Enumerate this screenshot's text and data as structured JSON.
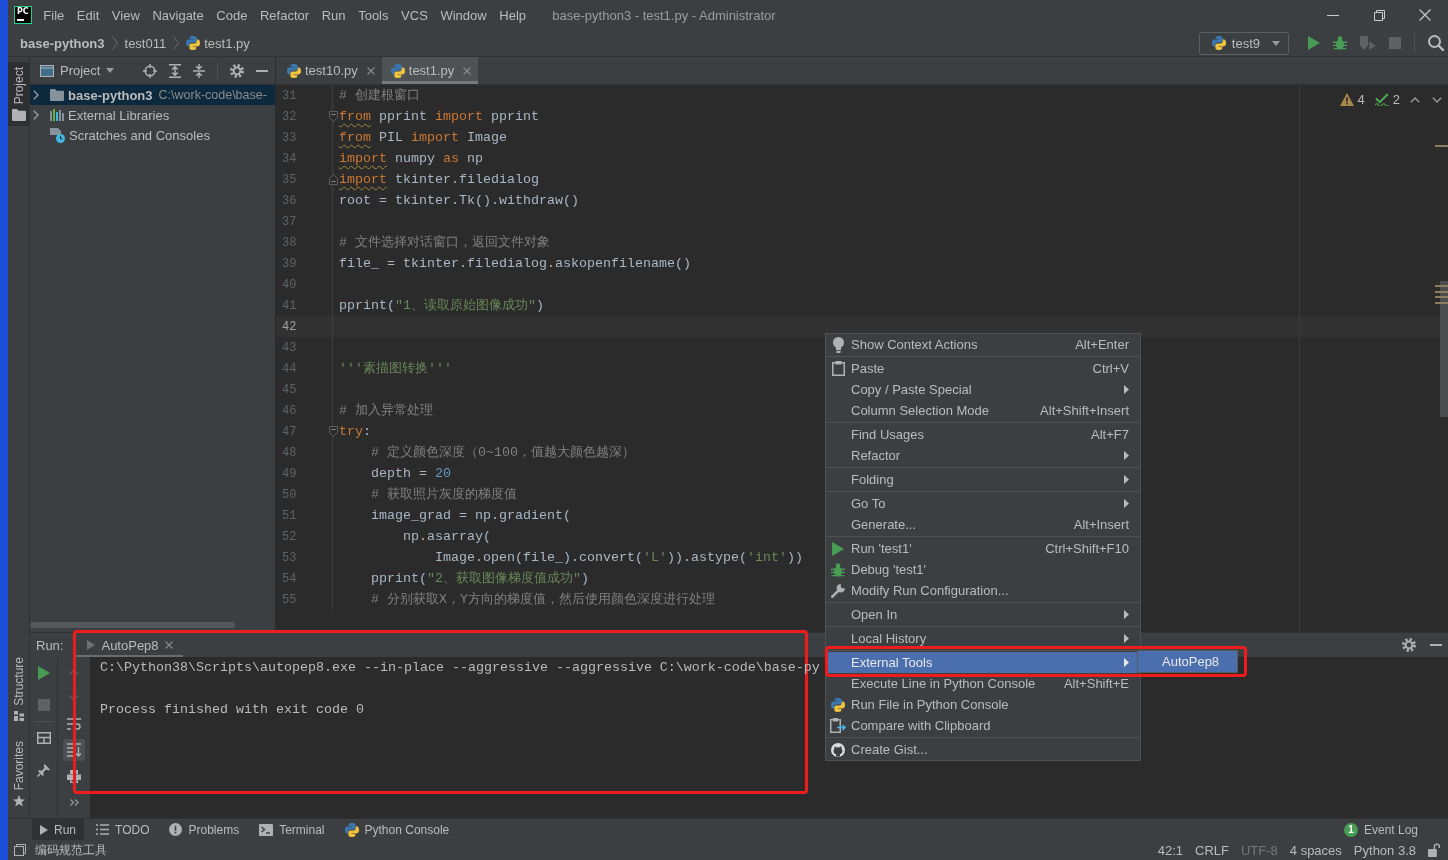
{
  "title_bar": {
    "logo": "PC",
    "menus": [
      "File",
      "Edit",
      "View",
      "Navigate",
      "Code",
      "Refactor",
      "Run",
      "Tools",
      "VCS",
      "Window",
      "Help"
    ],
    "title": "base-python3 - test1.py - Administrator"
  },
  "nav_bar": {
    "breadcrumbs": [
      {
        "kind": "project",
        "label": "base-python3"
      },
      {
        "kind": "folder",
        "label": "test011"
      },
      {
        "kind": "file",
        "label": "test1.py"
      }
    ],
    "run_config": "test9",
    "actions": [
      {
        "disabled": false
      },
      {
        "disabled": false
      },
      {
        "disabled": true
      },
      {
        "disabled": true
      }
    ]
  },
  "tool_strip": {
    "top": [
      {
        "label": "Project",
        "selected": true
      }
    ],
    "bottom": [
      {
        "label": "Structure",
        "selected": false
      },
      {
        "label": "Favorites",
        "selected": false
      }
    ]
  },
  "project_panel": {
    "title": "Project",
    "tree": [
      {
        "kind": "project",
        "label": "base-python3",
        "path": "C:\\work-code\\base-",
        "selected": true,
        "expanded": false
      },
      {
        "kind": "library",
        "label": "External Libraries",
        "selected": false,
        "expanded": false
      },
      {
        "kind": "scratches",
        "label": "Scratches and Consoles",
        "selected": false
      }
    ]
  },
  "editor": {
    "tabs": [
      {
        "label": "test10.py",
        "selected": false
      },
      {
        "label": "test1.py",
        "selected": true
      }
    ],
    "inspections": [
      {
        "kind": "warning",
        "count": "4"
      },
      {
        "kind": "weak_warning",
        "count": "2"
      }
    ],
    "lines": [
      {
        "number": "31",
        "current": false,
        "warning": false,
        "tokens": [
          {
            "kind": "comment",
            "text": "# 创建根窗口"
          }
        ]
      },
      {
        "number": "32",
        "current": false,
        "warning": true,
        "fold": {
          "kind": "start"
        },
        "tokens": [
          {
            "kind": "keyword",
            "text": "from"
          },
          {
            "kind": "plain",
            "text": " pprint "
          },
          {
            "kind": "keyword",
            "text": "import"
          },
          {
            "kind": "plain",
            "text": " pprint"
          }
        ]
      },
      {
        "number": "33",
        "current": false,
        "warning": true,
        "tokens": [
          {
            "kind": "keyword",
            "text": "from"
          },
          {
            "kind": "plain",
            "text": " PIL "
          },
          {
            "kind": "keyword",
            "text": "import"
          },
          {
            "kind": "plain",
            "text": " Image"
          }
        ]
      },
      {
        "number": "34",
        "current": false,
        "warning": true,
        "tokens": [
          {
            "kind": "keyword",
            "text": "import"
          },
          {
            "kind": "plain",
            "text": " numpy "
          },
          {
            "kind": "keyword",
            "text": "as"
          },
          {
            "kind": "plain",
            "text": " np"
          }
        ]
      },
      {
        "number": "35",
        "current": false,
        "warning": true,
        "fold": {
          "kind": "end"
        },
        "tokens": [
          {
            "kind": "keyword",
            "text": "import"
          },
          {
            "kind": "plain",
            "text": " tkinter.filedialog"
          }
        ]
      },
      {
        "number": "36",
        "current": false,
        "warning": false,
        "tokens": [
          {
            "kind": "plain",
            "text": "root = tkinter.Tk().withdraw()"
          }
        ]
      },
      {
        "number": "37",
        "current": false
      },
      {
        "number": "38",
        "current": false,
        "warning": false,
        "tokens": [
          {
            "kind": "comment",
            "text": "# 文件选择对话窗口，返回文件对象"
          }
        ]
      },
      {
        "number": "39",
        "current": false,
        "warning": false,
        "tokens": [
          {
            "kind": "plain",
            "text": "file_ = tkinter.filedialog.askopenfilename()"
          }
        ]
      },
      {
        "number": "40",
        "current": false
      },
      {
        "number": "41",
        "current": false,
        "warning": false,
        "tokens": [
          {
            "kind": "plain",
            "text": "pprint("
          },
          {
            "kind": "string",
            "text": "\"1、读取原始图像成功\""
          },
          {
            "kind": "plain",
            "text": ")"
          }
        ]
      },
      {
        "number": "42",
        "current": true
      },
      {
        "number": "43",
        "current": false
      },
      {
        "number": "44",
        "current": false,
        "warning": false,
        "tokens": [
          {
            "kind": "string",
            "text": "'''素描图转换'''"
          }
        ]
      },
      {
        "number": "45",
        "current": false
      },
      {
        "number": "46",
        "current": false,
        "warning": false,
        "tokens": [
          {
            "kind": "comment",
            "text": "# 加入异常处理"
          }
        ]
      },
      {
        "number": "47",
        "current": false,
        "warning": false,
        "fold": {
          "kind": "start"
        },
        "tokens": [
          {
            "kind": "keyword",
            "text": "try"
          },
          {
            "kind": "plain",
            "text": ":"
          }
        ]
      },
      {
        "number": "48",
        "current": false,
        "warning": false,
        "tokens": [
          {
            "kind": "comment",
            "text": "    # 定义颜色深度（0~100，值越大颜色越深）"
          }
        ]
      },
      {
        "number": "49",
        "current": false,
        "warning": false,
        "tokens": [
          {
            "kind": "plain",
            "text": "    depth = "
          },
          {
            "kind": "number",
            "text": "20"
          }
        ]
      },
      {
        "number": "50",
        "current": false,
        "warning": false,
        "tokens": [
          {
            "kind": "comment",
            "text": "    # 获取照片灰度的梯度值"
          }
        ]
      },
      {
        "number": "51",
        "current": false,
        "warning": false,
        "tokens": [
          {
            "kind": "plain",
            "text": "    image_grad = np.gradient("
          }
        ]
      },
      {
        "number": "52",
        "current": false,
        "warning": false,
        "tokens": [
          {
            "kind": "plain",
            "text": "        np.asarray("
          }
        ]
      },
      {
        "number": "53",
        "current": false,
        "warning": false,
        "tokens": [
          {
            "kind": "plain",
            "text": "            Image.open(file_).convert("
          },
          {
            "kind": "string",
            "text": "'L'"
          },
          {
            "kind": "plain",
            "text": ")).astype("
          },
          {
            "kind": "string",
            "text": "'int'"
          },
          {
            "kind": "plain",
            "text": "))"
          }
        ]
      },
      {
        "number": "54",
        "current": false,
        "warning": false,
        "tokens": [
          {
            "kind": "plain",
            "text": "    pprint("
          },
          {
            "kind": "string",
            "text": "\"2、获取图像梯度值成功\""
          },
          {
            "kind": "plain",
            "text": ")"
          }
        ]
      },
      {
        "number": "55",
        "current": false,
        "warning": false,
        "tokens": [
          {
            "kind": "comment",
            "text": "    # 分别获取X，Y方向的梯度值，然后使用颜色深度进行处理"
          }
        ]
      }
    ]
  },
  "context_menu": {
    "groups": [
      {
        "items": [
          {
            "label": "Show Context Actions",
            "shortcut": "Alt+Enter",
            "submenu": false,
            "selected": false
          }
        ]
      },
      {
        "items": [
          {
            "label": "Paste",
            "shortcut": "Ctrl+V",
            "submenu": false,
            "selected": false
          },
          {
            "label": "Copy / Paste Special",
            "submenu": true,
            "selected": false
          },
          {
            "label": "Column Selection Mode",
            "shortcut": "Alt+Shift+Insert",
            "submenu": false,
            "selected": false
          }
        ]
      },
      {
        "items": [
          {
            "label": "Find Usages",
            "shortcut": "Alt+F7",
            "submenu": false,
            "selected": false
          },
          {
            "label": "Refactor",
            "submenu": true,
            "selected": false
          }
        ]
      },
      {
        "items": [
          {
            "label": "Folding",
            "submenu": true,
            "selected": false
          }
        ]
      },
      {
        "items": [
          {
            "label": "Go To",
            "submenu": true,
            "selected": false
          },
          {
            "label": "Generate...",
            "shortcut": "Alt+Insert",
            "submenu": false,
            "selected": false
          }
        ]
      },
      {
        "items": [
          {
            "label": "Run 'test1'",
            "shortcut": "Ctrl+Shift+F10",
            "submenu": false,
            "selected": false
          },
          {
            "label": "Debug 'test1'",
            "submenu": false,
            "selected": false
          },
          {
            "label": "Modify Run Configuration...",
            "submenu": false,
            "selected": false
          }
        ]
      },
      {
        "items": [
          {
            "label": "Open In",
            "submenu": true,
            "selected": false
          }
        ]
      },
      {
        "items": [
          {
            "label": "Local History",
            "submenu": true,
            "selected": false
          }
        ]
      },
      {
        "items": [
          {
            "label": "External Tools",
            "submenu": true,
            "selected": true
          },
          {
            "label": "Execute Line in Python Console",
            "shortcut": "Alt+Shift+E",
            "submenu": false,
            "selected": false
          },
          {
            "label": "Run File in Python Console",
            "submenu": false,
            "selected": false
          },
          {
            "label": "Compare with Clipboard",
            "submenu": false,
            "selected": false
          }
        ]
      },
      {
        "items": [
          {
            "label": "Create Gist...",
            "submenu": false,
            "selected": false
          }
        ]
      }
    ]
  },
  "submenu_popup": {
    "items": [
      {
        "label": "AutoPep8",
        "selected": true
      }
    ]
  },
  "run_panel": {
    "label": "Run:",
    "tabs": [
      {
        "label": "AutoPep8",
        "selected": true
      }
    ],
    "side_actions": [
      {
        "disabled": false
      },
      {
        "disabled": true
      }
    ],
    "nav_actions": [
      {
        "disabled": true
      },
      {
        "disabled": true
      }
    ],
    "toggles": [
      {
        "on": false
      },
      {
        "on": true
      }
    ],
    "output": [
      "C:\\Python38\\Scripts\\autopep8.exe --in-place --aggressive --aggressive C:\\work-code\\base-py",
      "Process finished with exit code 0"
    ]
  },
  "tool_window_bar": {
    "left": [
      {
        "label": "Run",
        "selected": true
      },
      {
        "label": "TODO",
        "selected": false
      },
      {
        "label": "Problems",
        "selected": false
      },
      {
        "label": "Terminal",
        "selected": false
      },
      {
        "label": "Python Console",
        "selected": false
      }
    ],
    "right": [
      {
        "label": "Event Log",
        "badge": "1",
        "selected": false
      }
    ]
  },
  "status_bar": {
    "message": "编码规范工具",
    "items": [
      {
        "label": "42:1",
        "disabled": false
      },
      {
        "label": "CRLF",
        "disabled": false
      },
      {
        "label": "UTF-8",
        "disabled": true
      },
      {
        "label": "4 spaces",
        "disabled": false
      },
      {
        "label": "Python 3.8",
        "disabled": false
      }
    ]
  }
}
